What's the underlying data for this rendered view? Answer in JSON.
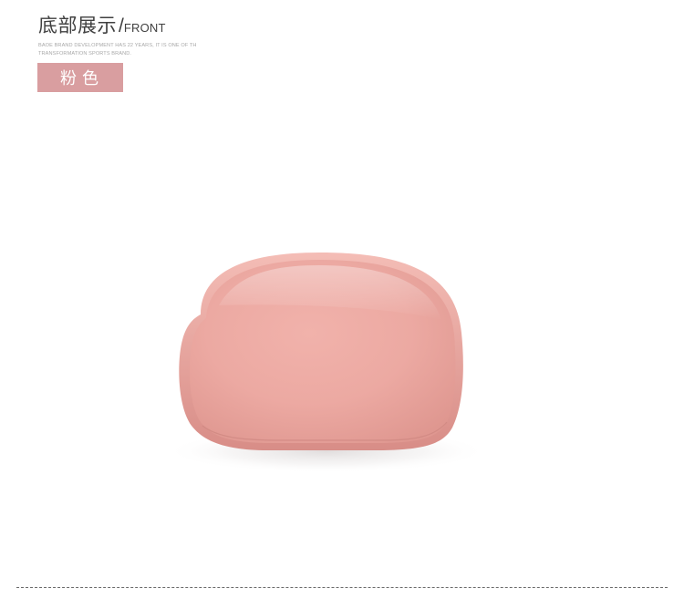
{
  "header": {
    "title_cn": "底部展示",
    "title_slash": "/",
    "title_en": "FRONT",
    "subtitle": "BAOE BRAND DEVELOPMENT HAS 22 YEARS, IT IS ONE OF TH TRANSFORMATION SPORTS BRAND."
  },
  "color_tag": {
    "label": "粉色",
    "background": "#d99ea0"
  },
  "product": {
    "icon": "pink-pouch-bottom-view",
    "fill_color": "#eaa6a0",
    "edge_color": "#e09892"
  }
}
